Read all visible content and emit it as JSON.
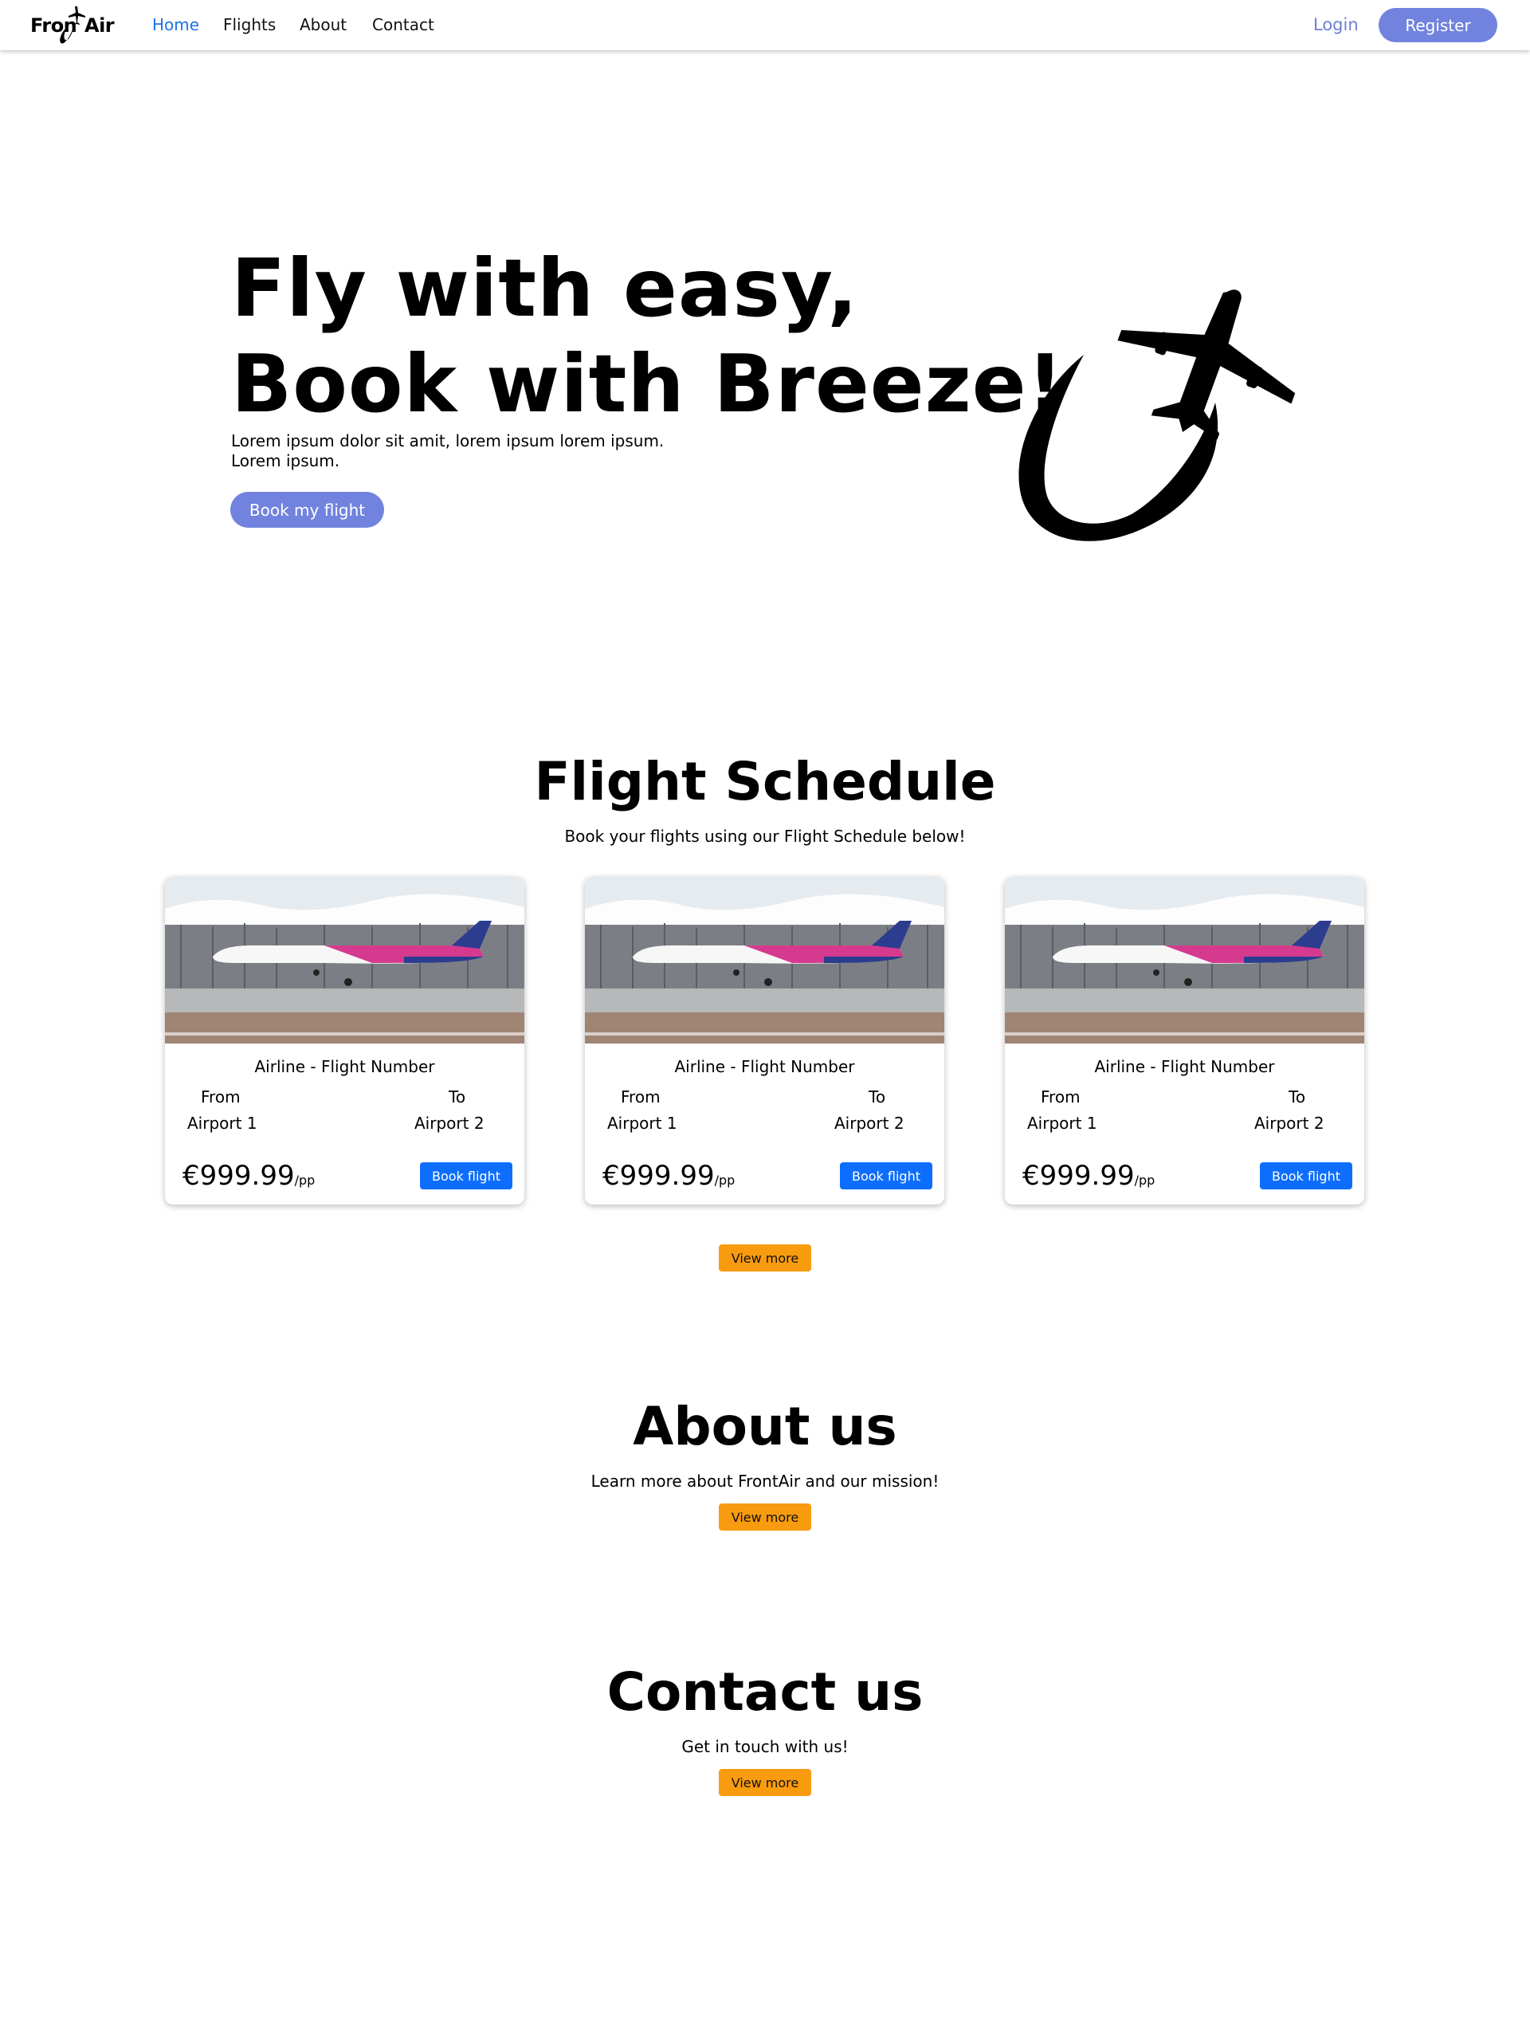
{
  "brand": {
    "logo_left": "Fron",
    "logo_right": "Air"
  },
  "nav": {
    "links": [
      "Home",
      "Flights",
      "About",
      "Contact"
    ],
    "active": "Home",
    "login": "Login",
    "register": "Register"
  },
  "hero": {
    "title_line1": "Fly with easy,",
    "title_line2": "Book with Breeze!",
    "subtitle_line1": "Lorem ipsum dolor sit amit, lorem ipsum lorem ipsum.",
    "subtitle_line2": "Lorem ipsum.",
    "cta": "Book my flight"
  },
  "schedule": {
    "title": "Flight Schedule",
    "subtitle": "Book your flights using our Flight Schedule below!",
    "view_more": "View more",
    "cards": [
      {
        "title": "Airline - Flight Number",
        "from_label": "From",
        "to_label": "To",
        "from": "Airport 1",
        "to": "Airport 2",
        "price": "€999.99",
        "unit": "/pp",
        "button": "Book flight"
      },
      {
        "title": "Airline - Flight Number",
        "from_label": "From",
        "to_label": "To",
        "from": "Airport 1",
        "to": "Airport 2",
        "price": "€999.99",
        "unit": "/pp",
        "button": "Book flight"
      },
      {
        "title": "Airline - Flight Number",
        "from_label": "From",
        "to_label": "To",
        "from": "Airport 1",
        "to": "Airport 2",
        "price": "€999.99",
        "unit": "/pp",
        "button": "Book flight"
      }
    ]
  },
  "about": {
    "title": "About us",
    "subtitle": "Learn more about FrontAir and our mission!",
    "button": "View more"
  },
  "contact": {
    "title": "Contact us",
    "subtitle": "Get in touch with us!",
    "button": "View more"
  },
  "colors": {
    "accent": "#7183de",
    "link_active": "#1a73e8",
    "book_button": "#0d6efd",
    "view_more": "#f89b0f"
  },
  "icons": [
    "airplane-logo-icon",
    "airplane-swoosh-icon",
    "airplane-photo"
  ]
}
